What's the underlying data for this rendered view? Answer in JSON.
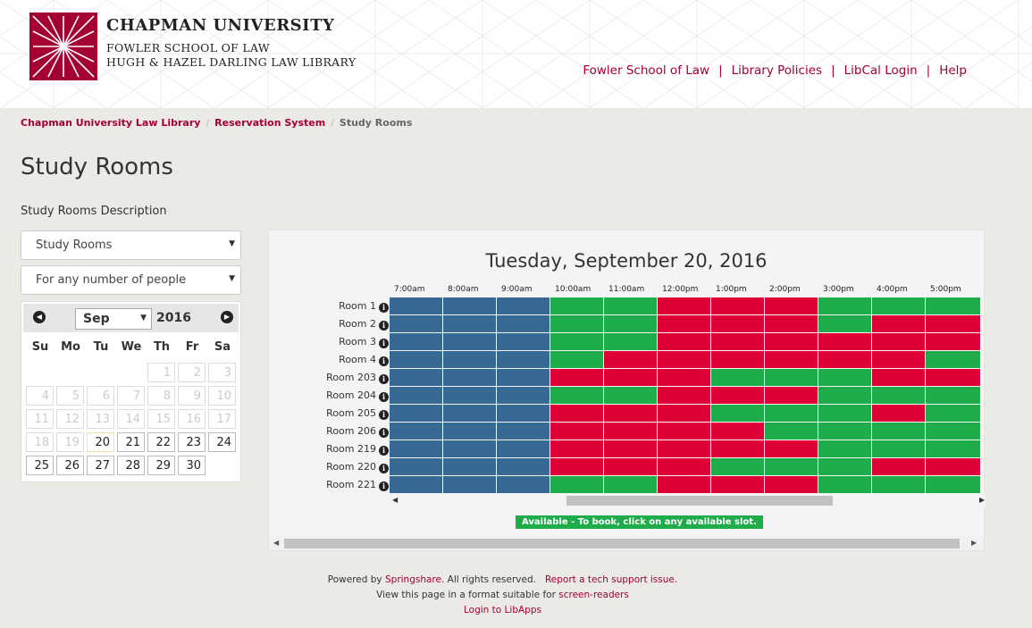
{
  "header": {
    "logo_title": "CHAPMAN UNIVERSITY",
    "logo_sub1": "FOWLER SCHOOL OF LAW",
    "logo_sub2": "HUGH & HAZEL DARLING LAW LIBRARY",
    "brand_color": "#a50034",
    "nav": [
      "Fowler School of Law",
      "Library Policies",
      "LibCal Login",
      "Help"
    ],
    "nav_sep": "|"
  },
  "breadcrumb": {
    "items": [
      "Chapman University Law Library",
      "Reservation System"
    ],
    "current": "Study Rooms",
    "sep": "/"
  },
  "page_title": "Study Rooms",
  "description_label": "Study Rooms Description",
  "filters": {
    "category": "Study Rooms",
    "capacity": "For any number of people"
  },
  "calendar": {
    "month": "Sep",
    "year": "2016",
    "prev_icon": "chevron-left-icon",
    "next_icon": "chevron-right-icon",
    "weekdays": [
      "Su",
      "Mo",
      "Tu",
      "We",
      "Th",
      "Fr",
      "Sa"
    ],
    "first_weekday_index": 4,
    "days_in_month": 30,
    "today": 20,
    "last_past_day": 19
  },
  "grid": {
    "date_title": "Tuesday, September 20, 2016",
    "times": [
      "7:00am",
      "8:00am",
      "9:00am",
      "10:00am",
      "11:00am",
      "12:00pm",
      "1:00pm",
      "2:00pm",
      "3:00pm",
      "4:00pm",
      "5:00pm"
    ],
    "status_colors": {
      "unavailable": "#386894",
      "available": "#1fad4c",
      "booked": "#df0038"
    },
    "rooms": [
      {
        "name": "Room 1",
        "slots": "uuuaabbbaaa"
      },
      {
        "name": "Room 2",
        "slots": "uuuaabbbabb"
      },
      {
        "name": "Room 3",
        "slots": "uuuaabbbbbb"
      },
      {
        "name": "Room 4",
        "slots": "uuuabbbbbba"
      },
      {
        "name": "Room 203",
        "slots": "uuubbbaaabb"
      },
      {
        "name": "Room 204",
        "slots": "uuuaabbbaaa"
      },
      {
        "name": "Room 205",
        "slots": "uuubbbaaaba"
      },
      {
        "name": "Room 206",
        "slots": "uuubbbbaaaa"
      },
      {
        "name": "Room 219",
        "slots": "uuubbbbbaaa"
      },
      {
        "name": "Room 220",
        "slots": "uuubbbaaabb"
      },
      {
        "name": "Room 221",
        "slots": "uuuaabbbaaa"
      }
    ],
    "info_icon": "info-icon",
    "legend_available": "Available - To book, click on any available slot."
  },
  "footer": {
    "powered_prefix": "Powered by ",
    "powered_link": "Springshare",
    "powered_suffix": ". All rights reserved.",
    "report_link": "Report a tech support issue.",
    "screen_reader_prefix": "View this page in a format suitable for ",
    "screen_reader_link": "screen-readers",
    "login_link": "Login to LibApps"
  }
}
